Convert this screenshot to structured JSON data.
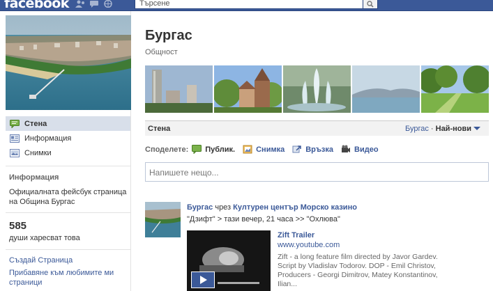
{
  "topbar": {
    "logo": "facebook",
    "search_placeholder": "Търсене"
  },
  "sidebar": {
    "nav": [
      {
        "label": "Стена",
        "icon": "wall-icon",
        "active": true
      },
      {
        "label": "Информация",
        "icon": "info-icon",
        "active": false
      },
      {
        "label": "Снимки",
        "icon": "photos-icon",
        "active": false
      }
    ],
    "info_heading": "Информация",
    "info_text": "Официалната фейсбук страница на Община Бургас",
    "likes_count": "585",
    "likes_label": "души харесват това",
    "create_page": "Създай Страница",
    "add_favorites": "Прибавяне към любимите ми страници"
  },
  "page": {
    "title": "Бургас",
    "category": "Общност"
  },
  "wall": {
    "title": "Стена",
    "filter_name": "Бургас",
    "filter_sep": " · ",
    "filter_mode": "Най-нови",
    "share_label": "Споделете:",
    "share_options": [
      "Публик.",
      "Снимка",
      "Връзка",
      "Видео"
    ],
    "composer_placeholder": "Напишете нещо..."
  },
  "post": {
    "author": "Бургас",
    "via": " чрез ",
    "via_page": "Културен център Морско казино",
    "message": "\"Дзифт\" > тази вечер, 21 часа >> \"Охлюва\"",
    "attachment": {
      "title": "Zift Trailer",
      "domain": "www.youtube.com",
      "description": "Zift - a long feature film directed by Javor Gardev. Script by Vladislav Todorov. DOP - Emil Christov, Producers - Georgi Dimitrov, Matey Konstantinov, Ilian..."
    }
  },
  "colors": {
    "brand": "#3b5998",
    "nav_active": "#d8dfea",
    "wall_bar": "#f2f2f2"
  }
}
